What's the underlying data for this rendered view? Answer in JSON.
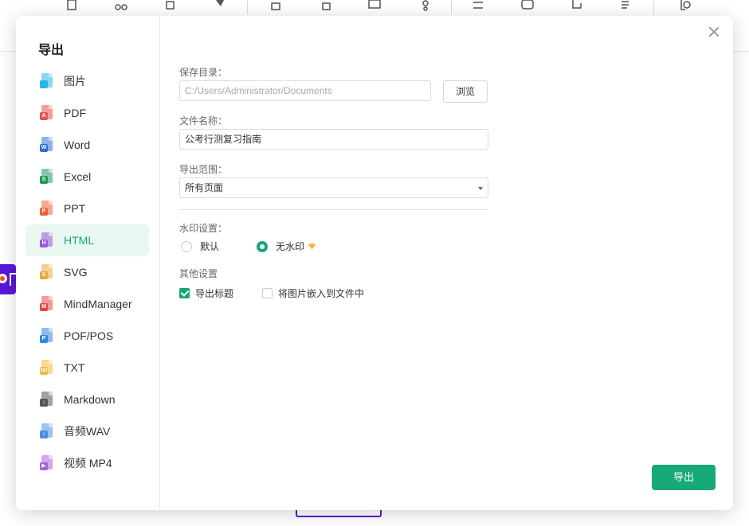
{
  "dialog": {
    "title": "导出",
    "close_icon": "close-icon"
  },
  "nav": [
    {
      "label": "图片",
      "icon": "image-file-icon",
      "color": "#2cb5e8",
      "badge": ""
    },
    {
      "label": "PDF",
      "icon": "pdf-file-icon",
      "color": "#e65252",
      "badge": "A"
    },
    {
      "label": "Word",
      "icon": "word-file-icon",
      "color": "#2f6fd6",
      "badge": "W"
    },
    {
      "label": "Excel",
      "icon": "excel-file-icon",
      "color": "#1e9a5a",
      "badge": "S"
    },
    {
      "label": "PPT",
      "icon": "ppt-file-icon",
      "color": "#e8643a",
      "badge": "P"
    },
    {
      "label": "HTML",
      "icon": "html-file-icon",
      "color": "#9b59d6",
      "badge": "H"
    },
    {
      "label": "SVG",
      "icon": "svg-file-icon",
      "color": "#e8a83a",
      "badge": "S"
    },
    {
      "label": "MindManager",
      "icon": "mindmanager-file-icon",
      "color": "#e04848",
      "badge": "M"
    },
    {
      "label": "POF/POS",
      "icon": "pof-pos-file-icon",
      "color": "#2f86e0",
      "badge": "P"
    },
    {
      "label": "TXT",
      "icon": "txt-file-icon",
      "color": "#f0b840",
      "badge": "txt"
    },
    {
      "label": "Markdown",
      "icon": "markdown-file-icon",
      "color": "#555555",
      "badge": "↓"
    },
    {
      "label": "音频WAV",
      "icon": "audio-file-icon",
      "color": "#4a8fe8",
      "badge": "♪"
    },
    {
      "label": "视频 MP4",
      "icon": "video-file-icon",
      "color": "#a563d8",
      "badge": "▶"
    }
  ],
  "active_nav": "HTML",
  "form": {
    "save_dir_label": "保存目录：",
    "save_dir_value": "C:/Users/Administrator/Documents",
    "browse_label": "浏览",
    "filename_label": "文件名称：",
    "filename_value": "公考行测复习指南",
    "range_label": "导出范围：",
    "range_value": "所有页面",
    "watermark_label": "水印设置：",
    "watermark_default": "默认",
    "watermark_none": "无水印",
    "watermark_selected": "无水印",
    "other_label": "其他设置",
    "opt_export_title": "导出标题",
    "opt_export_title_checked": true,
    "opt_embed_images": "将图片嵌入到文件中",
    "opt_embed_images_checked": false
  },
  "export_button": "导出",
  "colors": {
    "accent": "#17a97a",
    "active_bg": "#e9f7f1",
    "side_tab": "#5a17d9"
  }
}
